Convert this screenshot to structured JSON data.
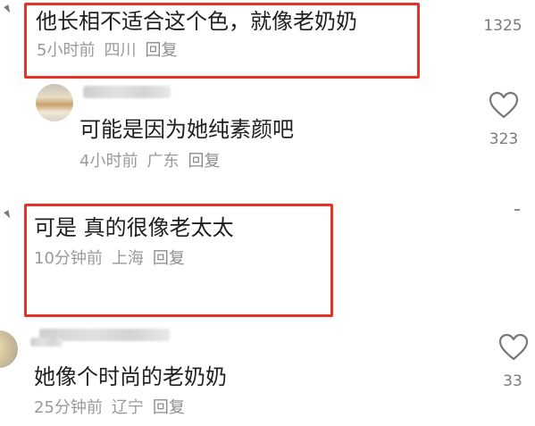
{
  "comments": [
    {
      "text": "他长相不适合这个色，就像老奶奶",
      "time": "5小时前",
      "location": "四川",
      "reply": "回复",
      "likes": "1325"
    },
    {
      "text": "可能是因为她纯素颜吧",
      "time": "4小时前",
      "location": "广东",
      "reply": "回复",
      "likes": "323"
    },
    {
      "text": "可是 真的很像老太太",
      "time": "10分钟前",
      "location": "上海",
      "reply": "回复"
    },
    {
      "text": "她像个时尚的老奶奶",
      "time": "25分钟前",
      "location": "辽宁",
      "reply": "回复",
      "likes": "33"
    }
  ],
  "icons": {
    "like": "heart-outline-icon"
  },
  "colors": {
    "highlight_border": "#e5332a",
    "meta_text": "#9a9a9a",
    "main_text": "#1f1f1f"
  }
}
